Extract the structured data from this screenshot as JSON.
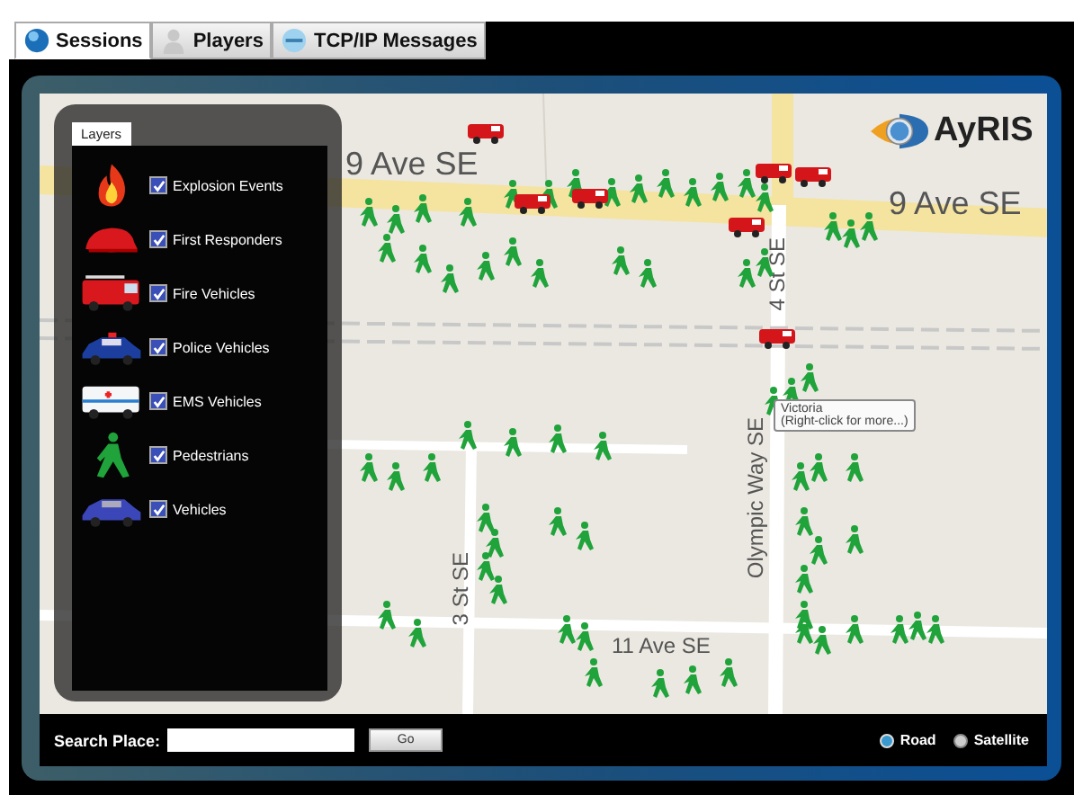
{
  "tabs": [
    {
      "label": "Sessions",
      "kind": "globe",
      "selected": true
    },
    {
      "label": "Players",
      "kind": "person",
      "selected": false
    },
    {
      "label": "TCP/IP Messages",
      "kind": "network",
      "selected": false
    }
  ],
  "map": {
    "logo": "AyRIS",
    "labels": [
      {
        "text": "9 Ave SE",
        "kind": "h"
      },
      {
        "text": "9 Ave SE",
        "kind": "h"
      },
      {
        "text": "4 St SE",
        "kind": "v"
      },
      {
        "text": "Olympic Way SE",
        "kind": "v"
      },
      {
        "text": "3 St SE",
        "kind": "v"
      },
      {
        "text": "11 Ave SE",
        "kind": "h"
      }
    ],
    "tooltip": {
      "title": "Victoria",
      "hint": "(Right-click for more...)"
    }
  },
  "layers": {
    "tab": "Layers",
    "items": [
      {
        "label": "Explosion Events",
        "kind": "fire",
        "checked": true
      },
      {
        "label": "First Responders",
        "kind": "helmet",
        "checked": true
      },
      {
        "label": "Fire Vehicles",
        "kind": "firetruck",
        "checked": true
      },
      {
        "label": "Police Vehicles",
        "kind": "police",
        "checked": true
      },
      {
        "label": "EMS Vehicles",
        "kind": "ambulance",
        "checked": true
      },
      {
        "label": "Pedestrians",
        "kind": "pedestrian",
        "checked": true
      },
      {
        "label": "Vehicles",
        "kind": "car",
        "checked": true
      }
    ]
  },
  "search": {
    "label": "Search Place:",
    "button": "Go"
  },
  "map_types": [
    {
      "label": "Road",
      "selected": true
    },
    {
      "label": "Satellite",
      "selected": false
    }
  ]
}
